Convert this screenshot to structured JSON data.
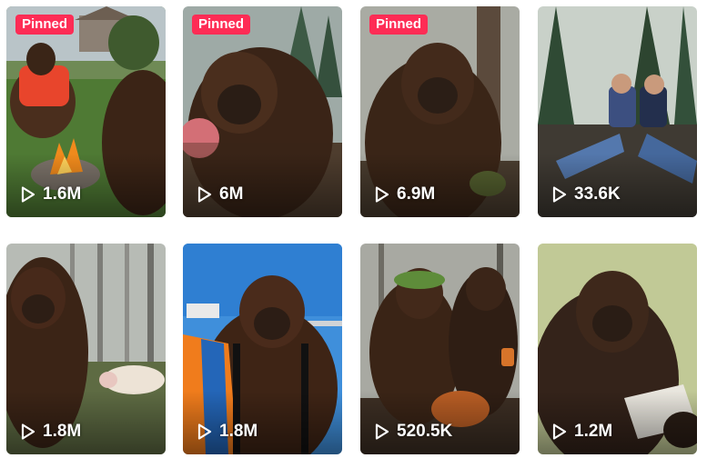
{
  "videos": [
    {
      "pinned": true,
      "pinned_label": "Pinned",
      "views": "1.6M",
      "thumbnail": "bigfoot-orange-shirt-campfire"
    },
    {
      "pinned": true,
      "pinned_label": "Pinned",
      "views": "6M",
      "thumbnail": "bigfoot-closeup-forest"
    },
    {
      "pinned": true,
      "pinned_label": "Pinned",
      "views": "6.9M",
      "thumbnail": "bigfoot-misty-forest"
    },
    {
      "pinned": false,
      "pinned_label": "",
      "views": "33.6K",
      "thumbnail": "two-men-sitting-in-forest"
    },
    {
      "pinned": false,
      "pinned_label": "",
      "views": "1.8M",
      "thumbnail": "bigfoot-with-lamb-foggy-woods"
    },
    {
      "pinned": false,
      "pinned_label": "",
      "views": "1.8M",
      "thumbnail": "bigfoot-skydiving-harness"
    },
    {
      "pinned": false,
      "pinned_label": "",
      "views": "520.5K",
      "thumbnail": "bigfoots-with-roast-turkey"
    },
    {
      "pinned": false,
      "pinned_label": "",
      "views": "1.2M",
      "thumbnail": "bigfoot-reading-paper"
    }
  ],
  "icons": {
    "views": "play-icon"
  },
  "colors": {
    "pinned_badge": "#fe2c55",
    "view_text": "#ffffff"
  }
}
